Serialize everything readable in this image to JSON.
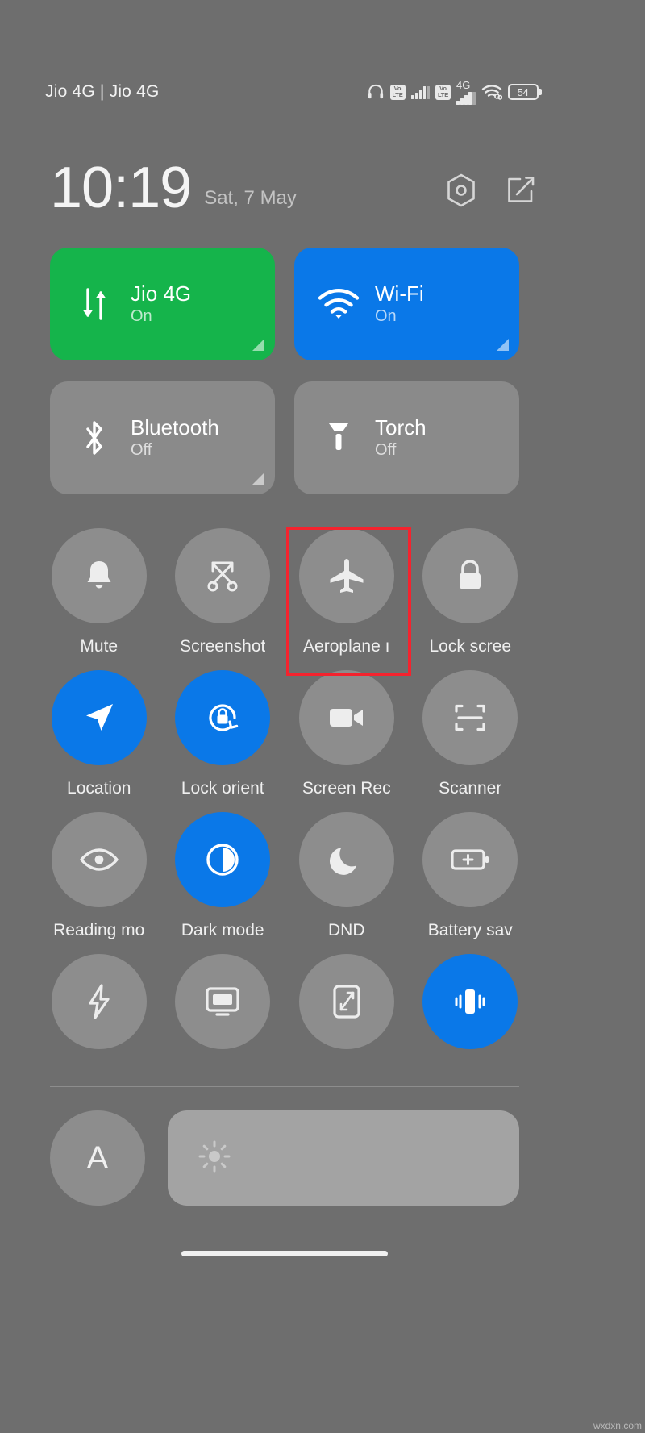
{
  "status_bar": {
    "carrier": "Jio 4G | Jio 4G",
    "volte_top": "Vo",
    "volte_bottom": "LTE",
    "network_label": "4G",
    "battery_level": "54",
    "icons": [
      "headphone-icon",
      "volte-icon",
      "signal-bars-icon",
      "volte-icon",
      "signal-bars-icon",
      "wifi-tethering-icon",
      "battery-icon"
    ]
  },
  "header": {
    "time": "10:19",
    "date": "Sat, 7 May",
    "settings_icon": "hexagon-settings-icon",
    "edit_icon": "edit-square-icon"
  },
  "big_tiles": [
    {
      "title": "Jio 4G",
      "state": "On",
      "icon": "mobile-data-icon",
      "active": true,
      "color": "#15b44b"
    },
    {
      "title": "Wi-Fi",
      "state": "On",
      "icon": "wifi-icon",
      "active": true,
      "color": "#0a78e8"
    },
    {
      "title": "Bluetooth",
      "state": "Off",
      "icon": "bluetooth-icon",
      "active": false,
      "color": "#8a8a8a"
    },
    {
      "title": "Torch",
      "state": "Off",
      "icon": "flashlight-icon",
      "active": false,
      "color": "#8a8a8a"
    }
  ],
  "toggles": {
    "rows": [
      [
        {
          "label": "Mute",
          "icon": "bell-icon",
          "active": false
        },
        {
          "label": "Screenshot",
          "icon": "scissors-icon",
          "active": false
        },
        {
          "label": "Aeroplane ı",
          "icon": "aeroplane-icon",
          "active": false,
          "highlighted": true
        },
        {
          "label": "Lock scree",
          "icon": "lock-icon",
          "active": false
        }
      ],
      [
        {
          "label": "Location",
          "icon": "navigation-arrow-icon",
          "active": true
        },
        {
          "label": "Lock orient",
          "icon": "lock-rotation-icon",
          "active": true
        },
        {
          "label": "Screen Rec",
          "icon": "video-camera-icon",
          "active": false
        },
        {
          "label": "Scanner",
          "icon": "scan-frame-icon",
          "active": false
        }
      ],
      [
        {
          "label": "Reading mo",
          "icon": "eye-icon",
          "active": false
        },
        {
          "label": "Dark mode",
          "icon": "contrast-icon",
          "active": true
        },
        {
          "label": "DND",
          "icon": "moon-icon",
          "active": false
        },
        {
          "label": "Battery sav",
          "icon": "battery-plus-icon",
          "active": false
        }
      ],
      [
        {
          "label": "",
          "icon": "lightning-bolt-icon",
          "active": false
        },
        {
          "label": "",
          "icon": "cast-screen-icon",
          "active": false
        },
        {
          "label": "",
          "icon": "expand-screen-icon",
          "active": false
        },
        {
          "label": "",
          "icon": "vibrate-icon",
          "active": true
        }
      ]
    ]
  },
  "brightness": {
    "auto_label": "A",
    "slider_icon": "sun-icon"
  },
  "watermark": "wxdxn.com",
  "colors": {
    "background": "#6e6e6e",
    "accent_blue": "#0a78e8",
    "accent_green": "#15b44b",
    "tile_inactive": "#8a8a8a",
    "highlight_red": "#f4232e"
  }
}
